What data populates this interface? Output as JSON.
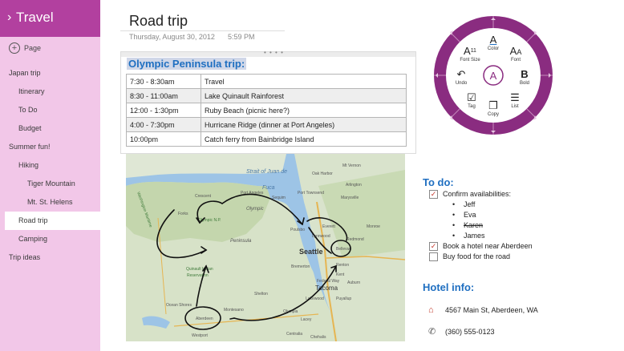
{
  "sidebar": {
    "notebook_title": "Travel",
    "add_page_label": "Page",
    "items": [
      {
        "label": "Japan trip",
        "level": 0
      },
      {
        "label": "Itinerary",
        "level": 1
      },
      {
        "label": "To Do",
        "level": 1
      },
      {
        "label": "Budget",
        "level": 1
      },
      {
        "label": "Summer fun!",
        "level": 0
      },
      {
        "label": "Hiking",
        "level": 1
      },
      {
        "label": "Tiger Mountain",
        "level": 2
      },
      {
        "label": "Mt. St. Helens",
        "level": 2
      },
      {
        "label": "Road trip",
        "level": 1,
        "selected": true
      },
      {
        "label": "Camping",
        "level": 1
      },
      {
        "label": "Trip ideas",
        "level": 0
      }
    ]
  },
  "page": {
    "title": "Road trip",
    "date": "Thursday, August 30, 2012",
    "time": "5:59 PM"
  },
  "trip": {
    "heading": "Olympic Peninsula trip:",
    "rows": [
      {
        "time": "7:30 - 8:30am",
        "activity": "Travel"
      },
      {
        "time": "8:30 - 11:00am",
        "activity": "Lake Quinault Rainforest"
      },
      {
        "time": "12:00 - 1:30pm",
        "activity": "Ruby Beach (picnic here?)"
      },
      {
        "time": "4:00 - 7:30pm",
        "activity": "Hurricane Ridge (dinner at Port Angeles)"
      },
      {
        "time": "10:00pm",
        "activity": "Catch ferry from Bainbridge Island"
      }
    ]
  },
  "map": {
    "labels": {
      "strait": "Strait of Juan de",
      "fuca": "Fuca",
      "port_angeles": "Port Angeles",
      "crescent": "Crescent",
      "forks": "Forks",
      "olympic_np": "Olympic N.P.",
      "olympic": "Olympic",
      "peninsula": "Peninsula",
      "marysville": "Marysville",
      "everett": "Everett",
      "lynnwood": "Lynnwood",
      "seattle": "Seattle",
      "bellevue": "Bellevue",
      "redmond": "Redmond",
      "tacoma": "Tacoma",
      "olympia": "Olympia",
      "aberdeen": "Aberdeen",
      "westport": "Westport",
      "quinault": "Quinault Indian",
      "reservation": "Reservation",
      "bremerton": "Bremerton",
      "shelton": "Shelton",
      "lacey": "Lacey",
      "puyallup": "Puyallup",
      "renton": "Renton",
      "kent": "Kent",
      "federal_way": "Federal Way",
      "auburn": "Auburn",
      "lakewood": "Lakewood",
      "centralia": "Centralia",
      "chehalis": "Chehalis",
      "ocean_shores": "Ocean Shores",
      "montesano": "Montesano",
      "arlington": "Arlington",
      "oak_harbor": "Oak Harbor",
      "mt_vernon": "Mt Vernon",
      "monroe": "Monroe",
      "poulsbo": "Poulsbo",
      "washington": "Washington Maritime",
      "port_townsend": "Port Townsend",
      "sequim": "Sequim"
    }
  },
  "radial_menu": {
    "center_icon": "A",
    "buttons": {
      "font_size": "Font Size",
      "color": "Color",
      "font": "Font",
      "undo": "Undo",
      "bold": "Bold",
      "tag": "Tag",
      "copy": "Copy",
      "list": "List"
    },
    "colors": {
      "ring": "#8a2c80",
      "accent": "#a13a97"
    }
  },
  "todo": {
    "heading": "To do:",
    "items": [
      {
        "text": "Confirm availabilities:",
        "checked": true
      },
      {
        "text": "Book a hotel near Aberdeen",
        "checked": true
      },
      {
        "text": "Buy food for the road",
        "checked": false
      }
    ],
    "people": [
      {
        "name": "Jeff",
        "struck": false
      },
      {
        "name": "Eva",
        "struck": false
      },
      {
        "name": "Karen",
        "struck": true
      },
      {
        "name": "James",
        "struck": false
      }
    ]
  },
  "hotel": {
    "heading": "Hotel info:",
    "address": "4567 Main St, Aberdeen, WA",
    "phone": "(360) 555-0123",
    "address_icon": "home-icon",
    "phone_icon": "phone-icon"
  },
  "colors": {
    "sidebar_bg": "#f2c7e8",
    "sidebar_header": "#b2409f",
    "heading_blue": "#1f6fc1"
  }
}
